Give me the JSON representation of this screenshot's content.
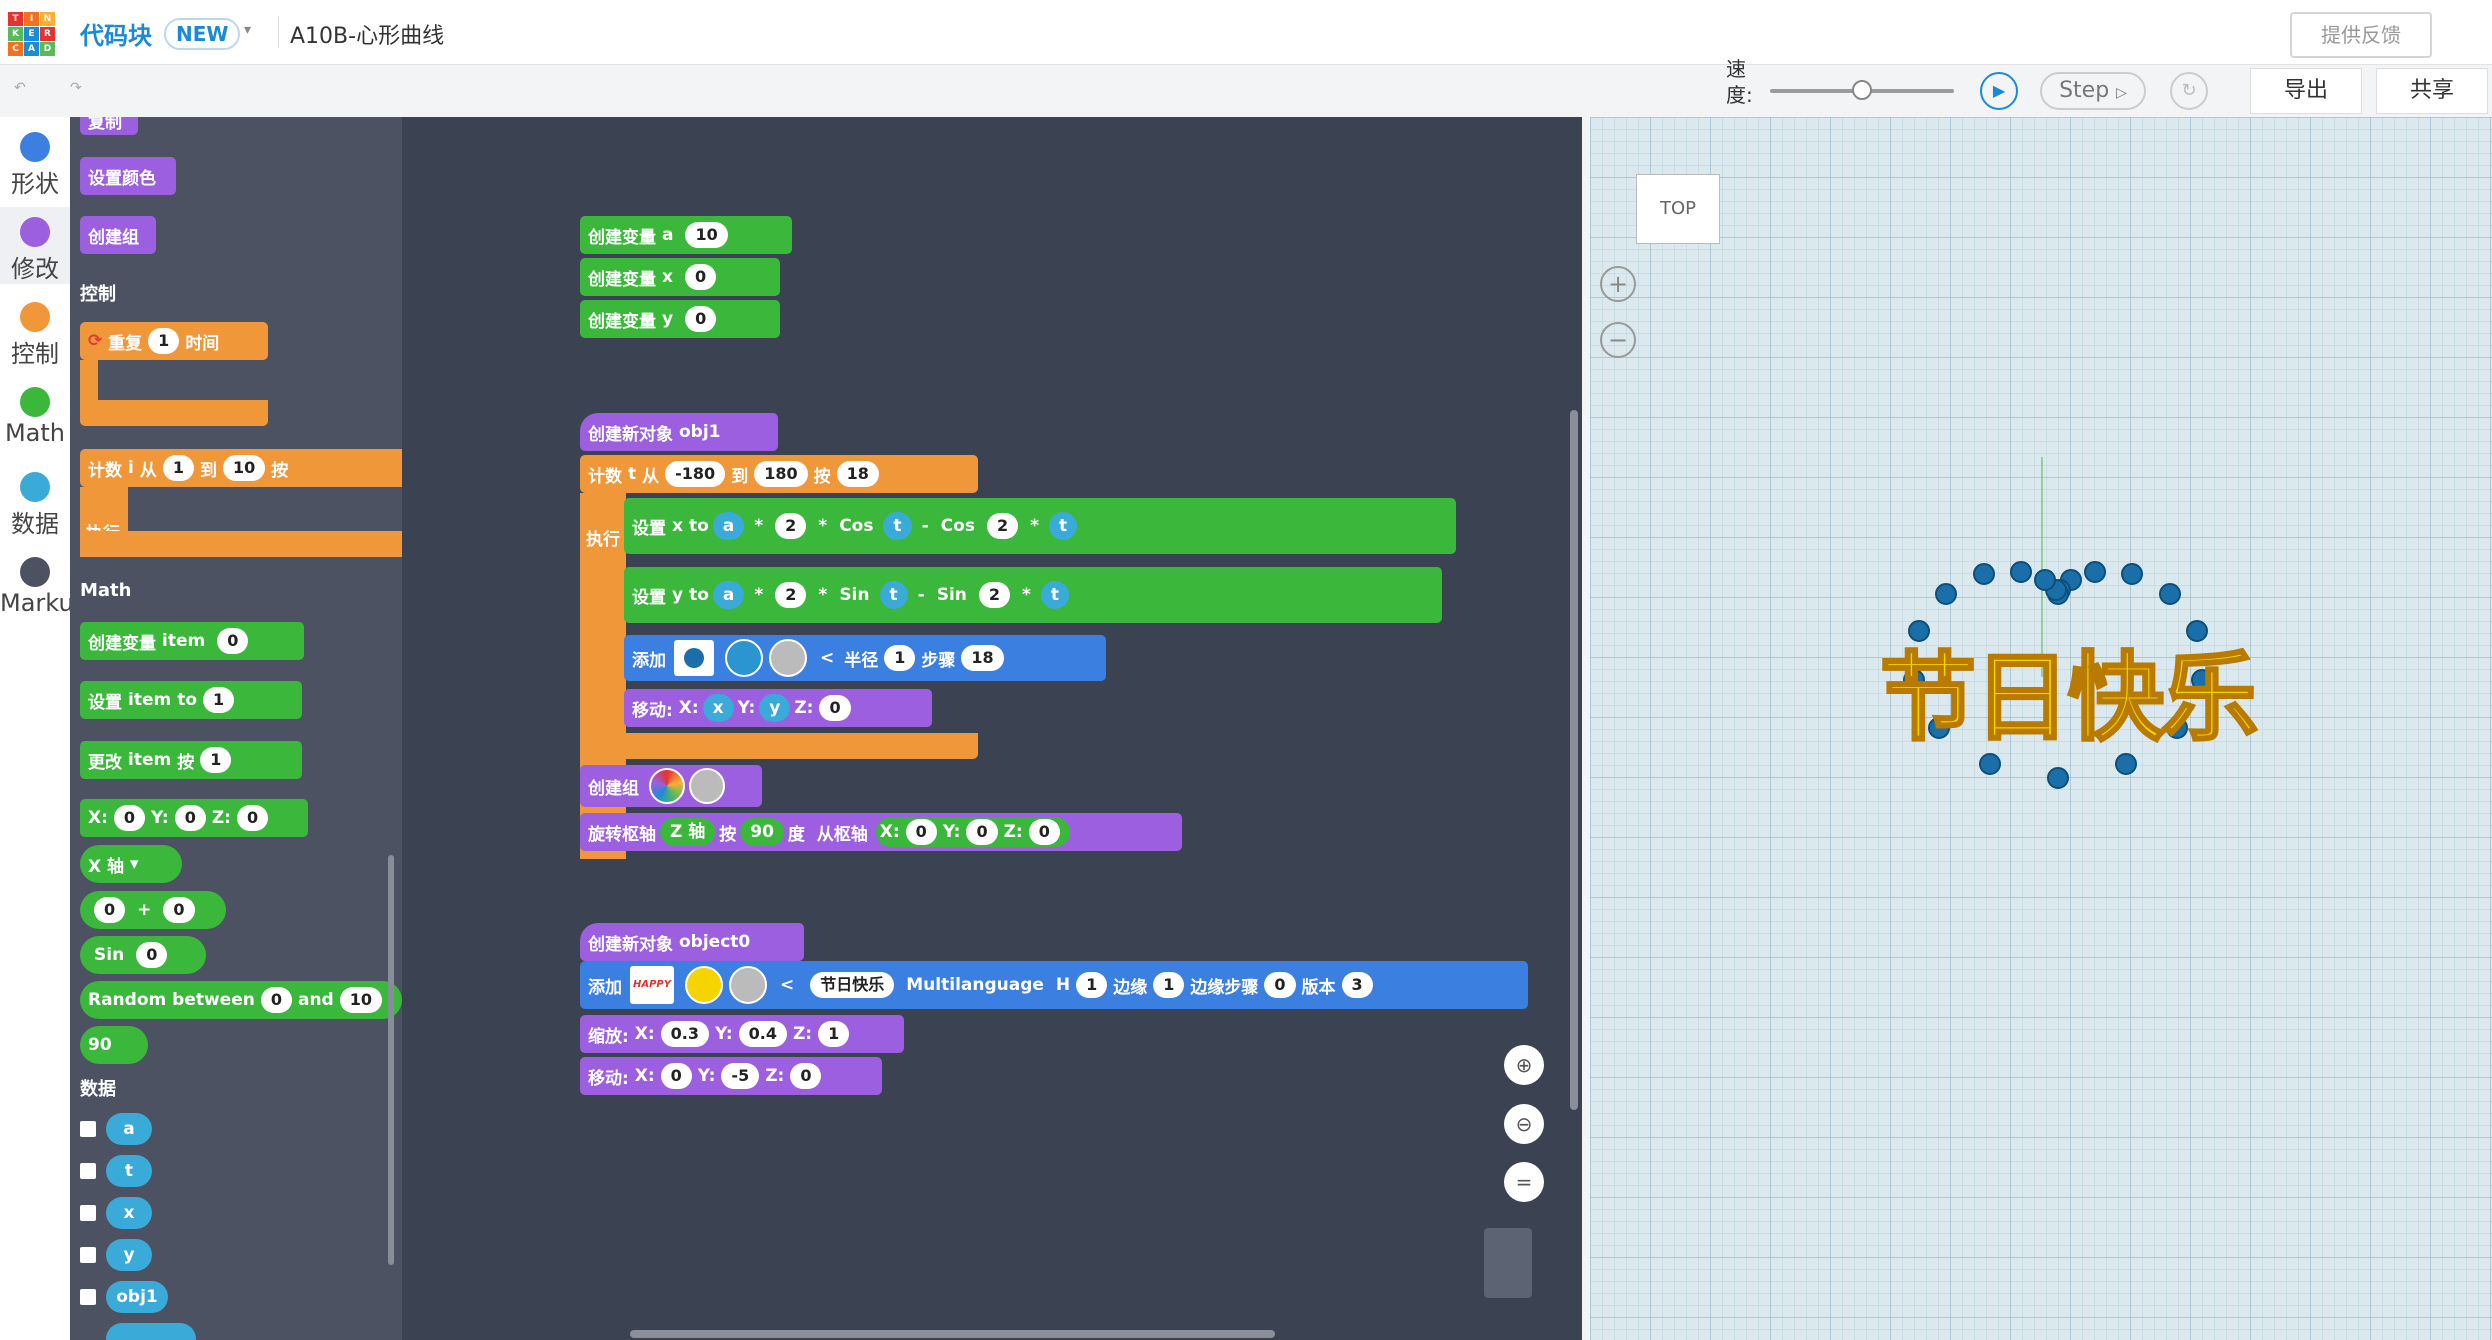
{
  "topbar": {
    "logo_letters": [
      "T",
      "I",
      "N",
      "K",
      "E",
      "R",
      "C",
      "A",
      "D"
    ],
    "logo_colors": [
      "#e5322d",
      "#f37021",
      "#fbb034",
      "#5cb85c",
      "#1b8dd8",
      "#e5322d",
      "#f37021",
      "#1b8dd8",
      "#5cb85c"
    ],
    "app_title": "代码块",
    "new_badge": "NEW",
    "project_name": "A10B-心形曲线",
    "right_button": "提供反馈"
  },
  "toolbar": {
    "speed_label": "速度:",
    "speed_value": 0.5,
    "step_label": "Step",
    "export_label": "导出",
    "share_label": "共享"
  },
  "categories": [
    {
      "label": "形状",
      "color": "#3b7fe0"
    },
    {
      "label": "修改",
      "color": "#9c5fe0"
    },
    {
      "label": "控制",
      "color": "#f0973a"
    },
    {
      "label": "Math",
      "color": "#3bb83b"
    },
    {
      "label": "数据",
      "color": "#3aaad8"
    },
    {
      "label": "Marku",
      "color": "#4c5262"
    }
  ],
  "flyout": {
    "copy": "复制",
    "set_color": "设置颜色",
    "create_group": "创建组",
    "control_title": "控制",
    "repeat": "重复",
    "repeat_n": "1",
    "repeat_time": "时间",
    "count": "计数",
    "count_var": "i",
    "count_from": "从",
    "count_from_v": "1",
    "count_to": "到",
    "count_to_v": "10",
    "count_by": "按",
    "do": "执行",
    "math_title": "Math",
    "create_var": "创建变量",
    "item": "item",
    "zero": "0",
    "set": "设置",
    "to": "to",
    "one": "1",
    "change": "更改",
    "by": "按",
    "x_lbl": "X:",
    "y_lbl": "Y:",
    "z_lbl": "Z:",
    "axis": "X 轴",
    "plus": "+",
    "sin": "Sin",
    "random_between": "Random between",
    "and": "and",
    "ten": "10",
    "ninety": "90",
    "data_title": "数据",
    "vars": [
      "a",
      "t",
      "x",
      "y",
      "obj1"
    ]
  },
  "workspace": {
    "create_var": "创建变量",
    "var_a": "a",
    "var_a_val": "10",
    "var_x": "x",
    "var_x_val": "0",
    "var_y": "y",
    "var_y_val": "0",
    "new_object": "创建新对象",
    "obj1": "obj1",
    "count": "计数",
    "t": "t",
    "from": "从",
    "from_v": "-180",
    "to_zh": "到",
    "to_v": "180",
    "by": "按",
    "by_v": "18",
    "do": "执行",
    "set": "设置",
    "to": "to",
    "a": "a",
    "times": "*",
    "two": "2",
    "cos": "Cos",
    "sin": "Sin",
    "minus": "-",
    "add": "添加",
    "radius": "半径",
    "radius_v": "1",
    "steps": "步骤",
    "steps_v": "18",
    "move": "移动:",
    "x_lbl": "X:",
    "y_lbl": "Y:",
    "z_lbl": "Z:",
    "x": "x",
    "y": "y",
    "zero": "0",
    "create_group": "创建组",
    "rotate_axis": "旋转枢轴",
    "z_axis": "Z 轴",
    "rot_by": "按",
    "rot_deg": "90",
    "degree": "度",
    "from_axis": "从枢轴",
    "object0": "object0",
    "text_value": "节日快乐",
    "text_preview": "HAPPY",
    "font": "Multilanguage",
    "h": "H",
    "h_v": "1",
    "edge": "边缘",
    "edge_v": "1",
    "edge_step": "边缘步骤",
    "edge_step_v": "0",
    "version": "版本",
    "version_v": "3",
    "scale": "缩放:",
    "sx": "0.3",
    "sy": "0.4",
    "sz": "1",
    "mx": "0",
    "my": "-5",
    "mz": "0"
  },
  "viewer": {
    "view_cube": "TOP",
    "heart_text": "节日快乐",
    "text_color": "#f5d400",
    "dot_color": "#1a6fa8"
  }
}
